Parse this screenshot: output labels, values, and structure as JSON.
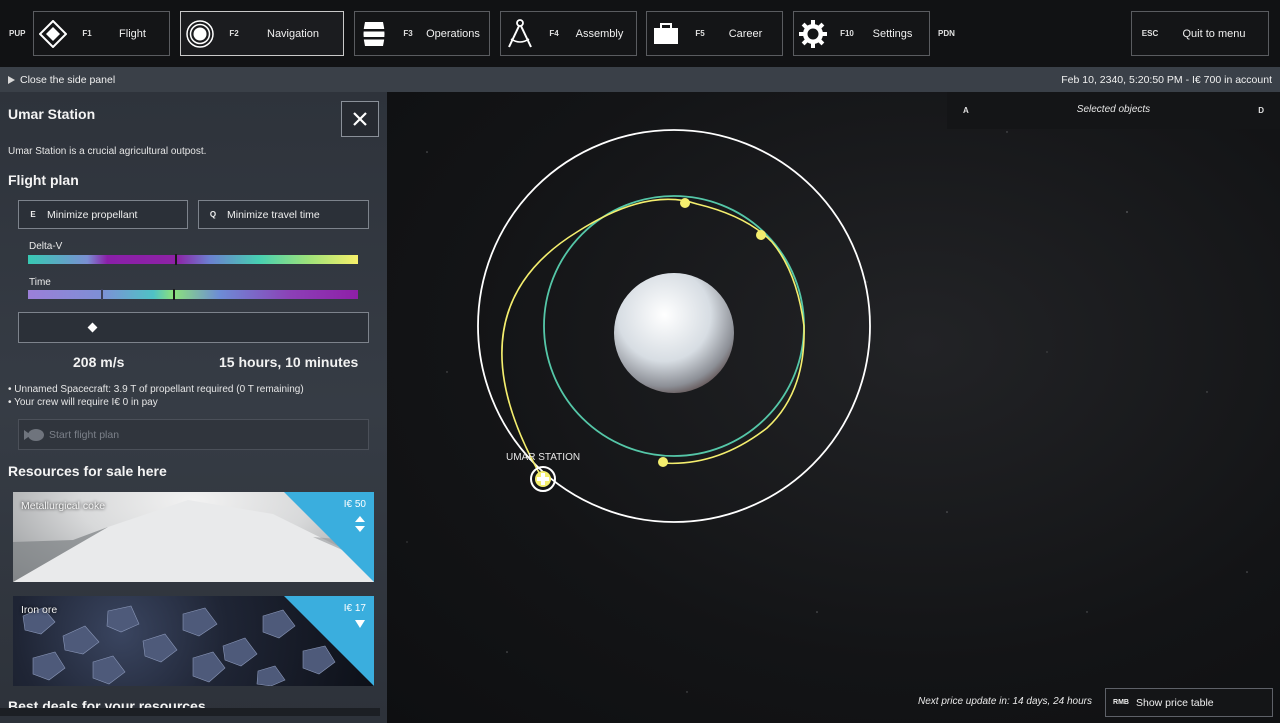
{
  "topbar": {
    "left_hint": "PUP",
    "right_hint": "PDN",
    "items": [
      {
        "key": "F1",
        "label": "Flight",
        "icon": "compass-diamond-icon"
      },
      {
        "key": "F2",
        "label": "Navigation",
        "icon": "orbit-rings-icon"
      },
      {
        "key": "F3",
        "label": "Operations",
        "icon": "barrel-icon"
      },
      {
        "key": "F4",
        "label": "Assembly",
        "icon": "drafting-compass-icon"
      },
      {
        "key": "F5",
        "label": "Career",
        "icon": "briefcase-icon"
      },
      {
        "key": "F10",
        "label": "Settings",
        "icon": "gear-icon"
      }
    ],
    "quit": {
      "key": "ESC",
      "label": "Quit to menu"
    }
  },
  "statusbar": {
    "close_panel": "Close the side panel",
    "datetime": "Feb 10, 2340, 5:20:50 PM - I€ 700 in account"
  },
  "side_panel": {
    "title": "Umar Station",
    "description": "Umar Station is a crucial agricultural outpost.",
    "flight_plan": {
      "heading": "Flight plan",
      "min_propellant": {
        "key": "E",
        "label": "Minimize propellant"
      },
      "min_travel": {
        "key": "Q",
        "label": "Minimize travel time"
      },
      "delta_v_label": "Delta-V",
      "time_label": "Time",
      "delta_v_marker": 0.445,
      "time_marker": 0.44,
      "slider_position": 0.21,
      "delta_v_value": "208 m/s",
      "time_value": "15 hours, 10 minutes",
      "notes": [
        "• Unnamed Spacecraft: 3.9 T of propellant required (0 T remaining)",
        "• Your crew will require I€ 0 in pay"
      ],
      "start_label": "Start flight plan"
    },
    "resources": {
      "heading": "Resources for sale here",
      "items": [
        {
          "name": "Metallurgical coke",
          "price": "I€ 50"
        },
        {
          "name": "Iron ore",
          "price": "I€ 17"
        }
      ]
    },
    "best_deals_heading": "Best deals for your resources"
  },
  "map": {
    "selected_objects": {
      "left_key": "A",
      "label": "Selected objects",
      "right_key": "D"
    },
    "station_label": "UMAR STATION",
    "price_update": "Next price update in: 14 days, 24 hours",
    "price_table": {
      "key": "RMB",
      "label": "Show price table"
    },
    "colors": {
      "orbit_outer": "#ffffff",
      "orbit_inner": "#55c7a8",
      "transfer": "#f4ee6e"
    }
  }
}
